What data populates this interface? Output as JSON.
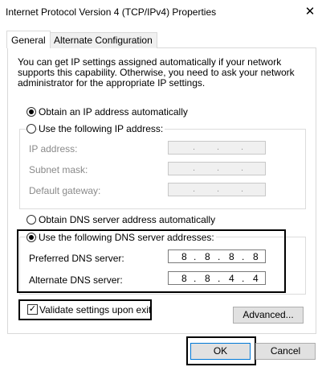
{
  "window": {
    "title": "Internet Protocol Version 4 (TCP/IPv4) Properties",
    "close_glyph": "✕"
  },
  "tabs": [
    {
      "label": "General",
      "selected": true
    },
    {
      "label": "Alternate Configuration",
      "selected": false
    }
  ],
  "description": "You can get IP settings assigned automatically if your network supports this capability. Otherwise, you need to ask your network administrator for the appropriate IP settings.",
  "ip_section": {
    "auto_label": "Obtain an IP address automatically",
    "auto_selected": true,
    "manual_label": "Use the following IP address:",
    "manual_selected": false,
    "fields": [
      {
        "label": "IP address:",
        "value": ".   .   ."
      },
      {
        "label": "Subnet mask:",
        "value": ".   .   ."
      },
      {
        "label": "Default gateway:",
        "value": ".   .   ."
      }
    ]
  },
  "dns_section": {
    "auto_label": "Obtain DNS server address automatically",
    "auto_selected": false,
    "manual_label": "Use the following DNS server addresses:",
    "manual_selected": true,
    "preferred_label": "Preferred DNS server:",
    "preferred_octets": [
      "8",
      "8",
      "8",
      "8"
    ],
    "alternate_label": "Alternate DNS server:",
    "alternate_octets": [
      "8",
      "8",
      "4",
      "4"
    ]
  },
  "validate": {
    "label": "Validate settings upon exit",
    "checked": true,
    "check_glyph": "✓"
  },
  "buttons": {
    "advanced": "Advanced...",
    "ok": "OK",
    "cancel": "Cancel"
  },
  "colors": {
    "ok_border": "#0078d7",
    "highlight": "#000000"
  }
}
